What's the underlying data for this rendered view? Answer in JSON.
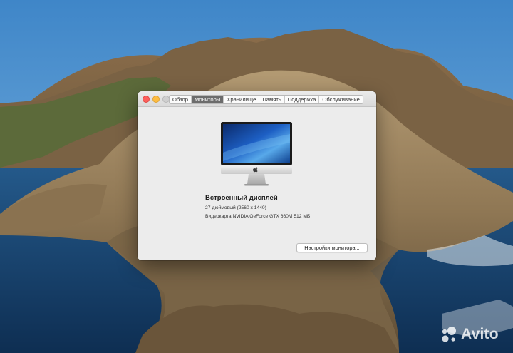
{
  "window": {
    "tabs": [
      {
        "label": "Обзор",
        "active": false
      },
      {
        "label": "Мониторы",
        "active": true
      },
      {
        "label": "Хранилище",
        "active": false
      },
      {
        "label": "Память",
        "active": false
      },
      {
        "label": "Поддержка",
        "active": false
      },
      {
        "label": "Обслуживание",
        "active": false
      }
    ],
    "display": {
      "name": "Встроенный дисплей",
      "resolution": "27-дюймовый (2560 x 1440)",
      "gpu": "Видеокарта NVIDIA GeForce GTX 660M 512 МБ"
    },
    "settings_button": "Настройки монитора..."
  },
  "watermark": {
    "text": "Avito"
  },
  "colors": {
    "close": "#fc605c",
    "minimize": "#fdbc40",
    "zoom_disabled": "#cfcfcf",
    "active_tab": "#6c6c6c",
    "window_bg": "#ececec"
  },
  "icons": [
    "apple-logo-icon",
    "imac-icon",
    "avito-logo-icon"
  ]
}
